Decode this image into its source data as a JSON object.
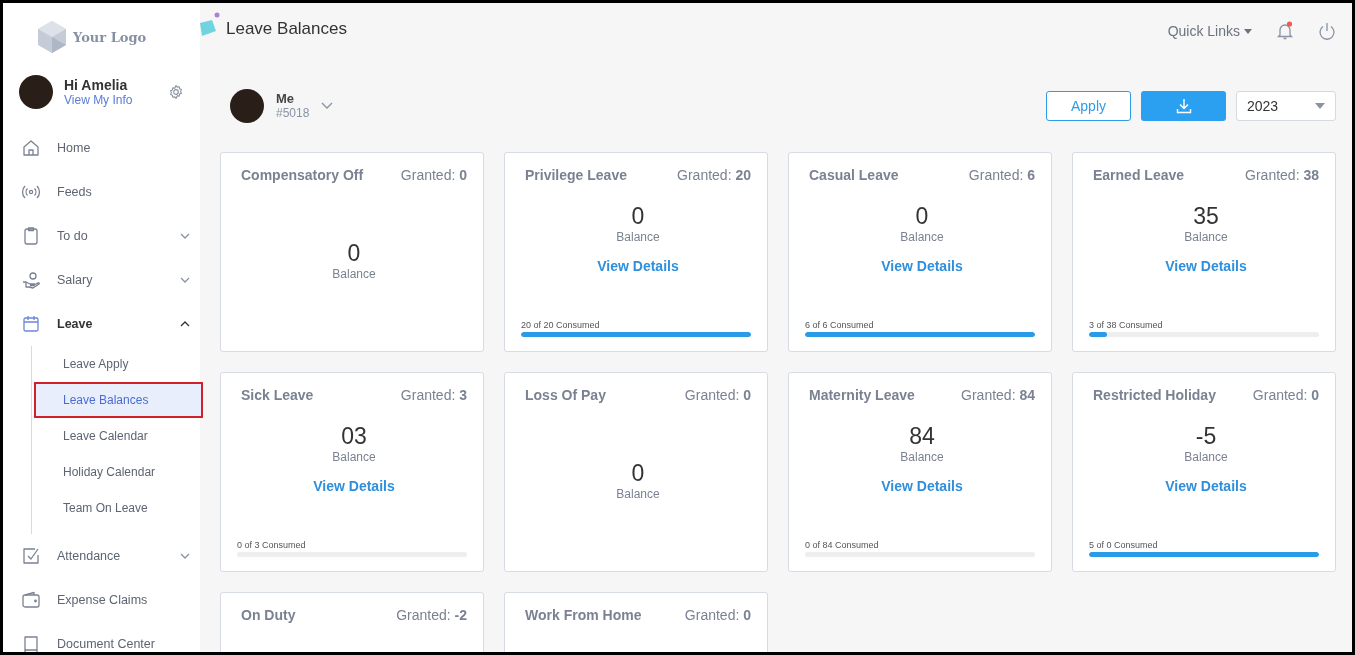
{
  "logo": {
    "text": "Your Logo"
  },
  "user": {
    "greeting": "Hi Amelia",
    "link": "View My Info"
  },
  "nav": [
    {
      "label": "Home",
      "selected": false
    },
    {
      "label": "Feeds",
      "selected": false
    },
    {
      "label": "To do",
      "expanded": false,
      "selected": false
    },
    {
      "label": "Salary",
      "expanded": false,
      "selected": false
    },
    {
      "label": "Leave",
      "expanded": true,
      "selected": true,
      "children": [
        {
          "label": "Leave Apply",
          "selected": false
        },
        {
          "label": "Leave Balances",
          "selected": true
        },
        {
          "label": "Leave Calendar",
          "selected": false
        },
        {
          "label": "Holiday Calendar",
          "selected": false
        },
        {
          "label": "Team On Leave",
          "selected": false
        }
      ]
    },
    {
      "label": "Attendance",
      "expanded": false,
      "selected": false
    },
    {
      "label": "Expense Claims",
      "selected": false
    },
    {
      "label": "Document Center",
      "selected": false
    }
  ],
  "header": {
    "title": "Leave Balances",
    "quick_links": "Quick Links"
  },
  "employee": {
    "name": "Me",
    "id": "#5018"
  },
  "actions": {
    "apply": "Apply",
    "year": "2023"
  },
  "cards": [
    {
      "kind": "simple",
      "title": "Compensatory Off",
      "granted": "Granted: **0**",
      "balance": "0",
      "balance_label": "Balance"
    },
    {
      "kind": "detail",
      "title": "Privilege Leave",
      "granted": "Granted: **20**",
      "balance": "0",
      "balance_label": "Balance",
      "link": "View Details",
      "consumed": "20 of 20 Consumed",
      "level": 1
    },
    {
      "kind": "detail",
      "title": "Casual Leave",
      "granted": "Granted: **6**",
      "balance": "0",
      "balance_label": "Balance",
      "link": "View Details",
      "consumed": "6 of 6 Consumed",
      "level": 1
    },
    {
      "kind": "detail",
      "title": "Earned Leave",
      "granted": "Granted: **38**",
      "balance": "35",
      "balance_label": "Balance",
      "link": "View Details",
      "consumed": "3 of 38 Consumed",
      "level": 0.08
    },
    {
      "kind": "detail",
      "title": "Sick Leave",
      "granted": "Granted: **3**",
      "balance": "03",
      "balance_label": "Balance",
      "link": "View Details",
      "consumed": "0 of 3 Consumed",
      "level": 0
    },
    {
      "kind": "simple",
      "title": "Loss Of Pay",
      "granted": "Granted: **0**",
      "balance": "0",
      "balance_label": "Balance"
    },
    {
      "kind": "detail",
      "title": "Maternity Leave",
      "granted": "Granted: **84**",
      "balance": "84",
      "balance_label": "Balance",
      "link": "View Details",
      "consumed": "0 of 84 Consumed",
      "level": 0
    },
    {
      "kind": "detail",
      "title": "Restricted Holiday",
      "granted": "Granted: **0**",
      "balance": "-5",
      "balance_label": "Balance",
      "link": "View Details",
      "consumed": "5 of 0 Consumed",
      "level": 1
    },
    {
      "kind": "cut",
      "title": "On Duty",
      "granted": "Granted: **-2**"
    },
    {
      "kind": "cut",
      "title": "Work From Home",
      "granted": "Granted: **0**"
    }
  ]
}
